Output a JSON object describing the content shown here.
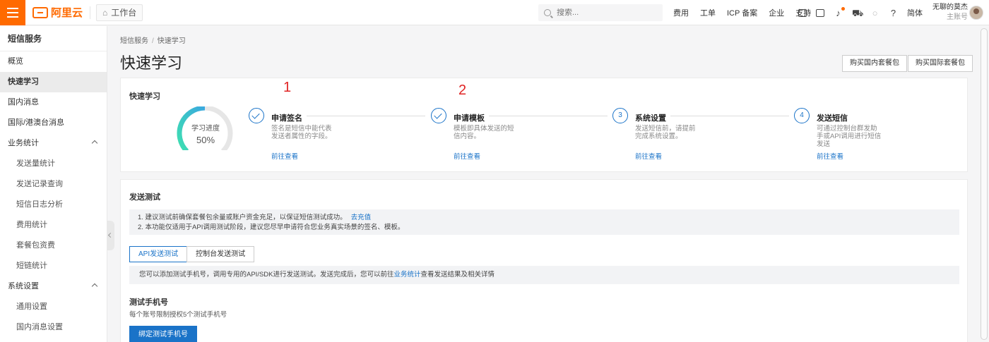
{
  "topbar": {
    "logo_text": "阿里云",
    "workbench_label": "工作台",
    "search_placeholder": "搜索...",
    "links": [
      "费用",
      "工单",
      "ICP 备案",
      "企业",
      "支持"
    ],
    "lang_label": "简体",
    "user_name": "无聊的莫杰",
    "user_role": "主账号",
    "brand_color": "#ff6a00"
  },
  "sidebar": {
    "title": "短信服务",
    "items": [
      {
        "label": "概览"
      },
      {
        "label": "快速学习"
      },
      {
        "label": "国内消息"
      },
      {
        "label": "国际/港澳台消息"
      },
      {
        "label": "业务统计"
      },
      {
        "label": "发送量统计"
      },
      {
        "label": "发送记录查询"
      },
      {
        "label": "短信日志分析"
      },
      {
        "label": "费用统计"
      },
      {
        "label": "套餐包资费"
      },
      {
        "label": "短链统计"
      },
      {
        "label": "系统设置"
      },
      {
        "label": "通用设置"
      },
      {
        "label": "国内消息设置"
      }
    ]
  },
  "main": {
    "breadcrumb": [
      "短信服务",
      "快速学习"
    ],
    "page_title": "快速学习",
    "buy_domestic": "购买国内套餐包",
    "buy_international": "购买国际套餐包",
    "quick_card": {
      "title": "快速学习",
      "progress_label": "学习进度",
      "progress_value": "50%",
      "progress_fraction": 0.5,
      "annotations": [
        "1",
        "2"
      ],
      "steps": [
        {
          "num": "",
          "title": "申请签名",
          "desc1": "签名是短信中能代表",
          "desc2": "发送者属性的字段。",
          "desc3": "",
          "link": "前往查看",
          "done": true
        },
        {
          "num": "",
          "title": "申请模板",
          "desc1": "模板即具体发送的短",
          "desc2": "信内容。",
          "desc3": "",
          "link": "前往查看",
          "done": true
        },
        {
          "num": "3",
          "title": "系统设置",
          "desc1": "发送短信前，请提前",
          "desc2": "完成系统设置。",
          "desc3": "",
          "link": "前往查看",
          "done": false
        },
        {
          "num": "4",
          "title": "发送短信",
          "desc1": "可通过控制台群发助",
          "desc2": "手或API调用进行短信",
          "desc3": "发送",
          "link": "前往查看",
          "done": false
        }
      ]
    },
    "send_test": {
      "title": "发送测试",
      "notice1": "1. 建议测试前确保套餐包余量或账户资金充足，以保证短信测试成功。",
      "notice1_link": "去充值",
      "notice2": "2. 本功能仅适用于API调用测试阶段，建议您尽早申请符合您业务真实场景的签名、模板。",
      "tabs": [
        "API发送测试",
        "控制台发送测试"
      ],
      "info_before": "您可以添加测试手机号，调用专用的API/SDK进行发送测试。发送完成后，您可以前往",
      "info_link": "业务统计",
      "info_after": "查看发送结果及相关详情",
      "phone_title": "测试手机号",
      "phone_desc": "每个账号限制授权5个测试手机号",
      "bind_button": "绑定测试手机号"
    }
  }
}
